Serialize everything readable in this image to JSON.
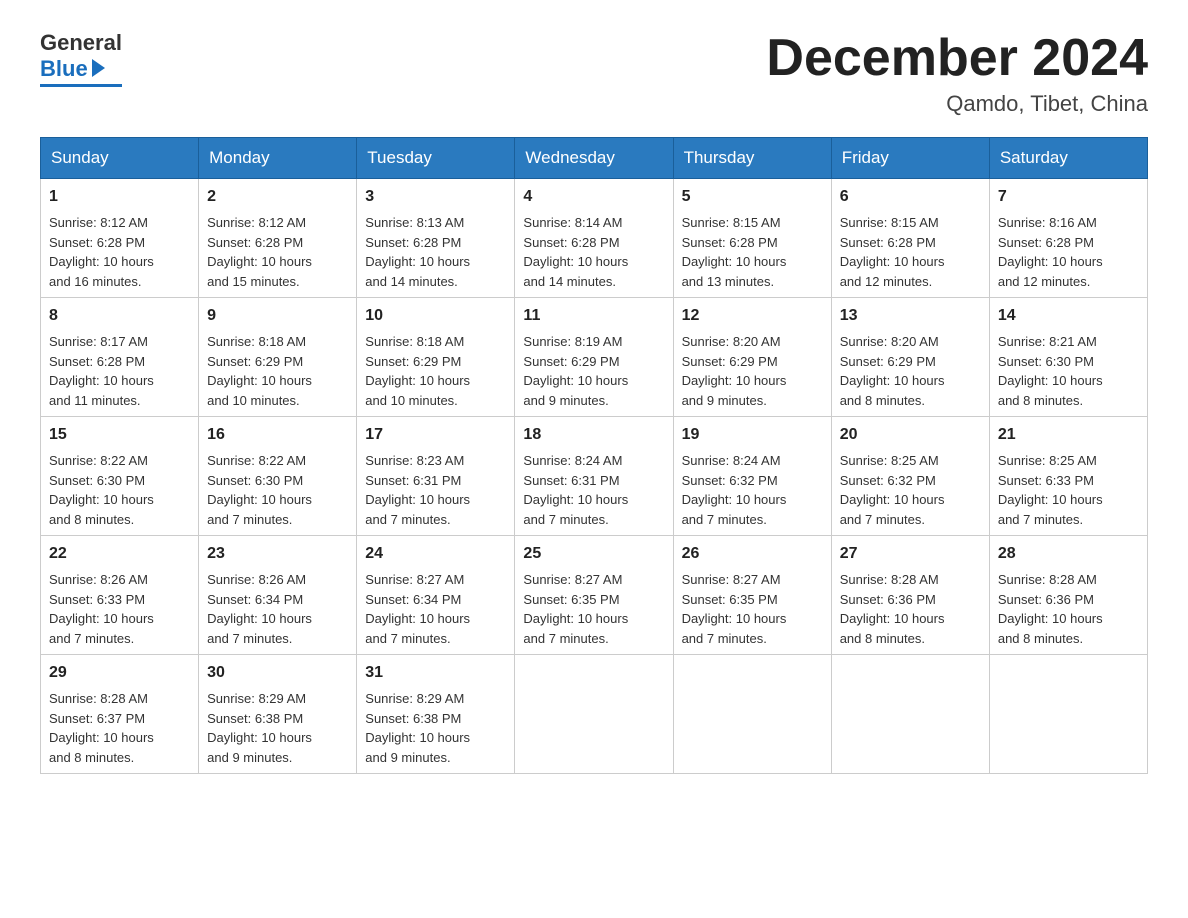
{
  "header": {
    "logo_general": "General",
    "logo_blue": "Blue",
    "month_title": "December 2024",
    "location": "Qamdo, Tibet, China"
  },
  "days_of_week": [
    "Sunday",
    "Monday",
    "Tuesday",
    "Wednesday",
    "Thursday",
    "Friday",
    "Saturday"
  ],
  "weeks": [
    [
      {
        "day": "1",
        "info": "Sunrise: 8:12 AM\nSunset: 6:28 PM\nDaylight: 10 hours\nand 16 minutes."
      },
      {
        "day": "2",
        "info": "Sunrise: 8:12 AM\nSunset: 6:28 PM\nDaylight: 10 hours\nand 15 minutes."
      },
      {
        "day": "3",
        "info": "Sunrise: 8:13 AM\nSunset: 6:28 PM\nDaylight: 10 hours\nand 14 minutes."
      },
      {
        "day": "4",
        "info": "Sunrise: 8:14 AM\nSunset: 6:28 PM\nDaylight: 10 hours\nand 14 minutes."
      },
      {
        "day": "5",
        "info": "Sunrise: 8:15 AM\nSunset: 6:28 PM\nDaylight: 10 hours\nand 13 minutes."
      },
      {
        "day": "6",
        "info": "Sunrise: 8:15 AM\nSunset: 6:28 PM\nDaylight: 10 hours\nand 12 minutes."
      },
      {
        "day": "7",
        "info": "Sunrise: 8:16 AM\nSunset: 6:28 PM\nDaylight: 10 hours\nand 12 minutes."
      }
    ],
    [
      {
        "day": "8",
        "info": "Sunrise: 8:17 AM\nSunset: 6:28 PM\nDaylight: 10 hours\nand 11 minutes."
      },
      {
        "day": "9",
        "info": "Sunrise: 8:18 AM\nSunset: 6:29 PM\nDaylight: 10 hours\nand 10 minutes."
      },
      {
        "day": "10",
        "info": "Sunrise: 8:18 AM\nSunset: 6:29 PM\nDaylight: 10 hours\nand 10 minutes."
      },
      {
        "day": "11",
        "info": "Sunrise: 8:19 AM\nSunset: 6:29 PM\nDaylight: 10 hours\nand 9 minutes."
      },
      {
        "day": "12",
        "info": "Sunrise: 8:20 AM\nSunset: 6:29 PM\nDaylight: 10 hours\nand 9 minutes."
      },
      {
        "day": "13",
        "info": "Sunrise: 8:20 AM\nSunset: 6:29 PM\nDaylight: 10 hours\nand 8 minutes."
      },
      {
        "day": "14",
        "info": "Sunrise: 8:21 AM\nSunset: 6:30 PM\nDaylight: 10 hours\nand 8 minutes."
      }
    ],
    [
      {
        "day": "15",
        "info": "Sunrise: 8:22 AM\nSunset: 6:30 PM\nDaylight: 10 hours\nand 8 minutes."
      },
      {
        "day": "16",
        "info": "Sunrise: 8:22 AM\nSunset: 6:30 PM\nDaylight: 10 hours\nand 7 minutes."
      },
      {
        "day": "17",
        "info": "Sunrise: 8:23 AM\nSunset: 6:31 PM\nDaylight: 10 hours\nand 7 minutes."
      },
      {
        "day": "18",
        "info": "Sunrise: 8:24 AM\nSunset: 6:31 PM\nDaylight: 10 hours\nand 7 minutes."
      },
      {
        "day": "19",
        "info": "Sunrise: 8:24 AM\nSunset: 6:32 PM\nDaylight: 10 hours\nand 7 minutes."
      },
      {
        "day": "20",
        "info": "Sunrise: 8:25 AM\nSunset: 6:32 PM\nDaylight: 10 hours\nand 7 minutes."
      },
      {
        "day": "21",
        "info": "Sunrise: 8:25 AM\nSunset: 6:33 PM\nDaylight: 10 hours\nand 7 minutes."
      }
    ],
    [
      {
        "day": "22",
        "info": "Sunrise: 8:26 AM\nSunset: 6:33 PM\nDaylight: 10 hours\nand 7 minutes."
      },
      {
        "day": "23",
        "info": "Sunrise: 8:26 AM\nSunset: 6:34 PM\nDaylight: 10 hours\nand 7 minutes."
      },
      {
        "day": "24",
        "info": "Sunrise: 8:27 AM\nSunset: 6:34 PM\nDaylight: 10 hours\nand 7 minutes."
      },
      {
        "day": "25",
        "info": "Sunrise: 8:27 AM\nSunset: 6:35 PM\nDaylight: 10 hours\nand 7 minutes."
      },
      {
        "day": "26",
        "info": "Sunrise: 8:27 AM\nSunset: 6:35 PM\nDaylight: 10 hours\nand 7 minutes."
      },
      {
        "day": "27",
        "info": "Sunrise: 8:28 AM\nSunset: 6:36 PM\nDaylight: 10 hours\nand 8 minutes."
      },
      {
        "day": "28",
        "info": "Sunrise: 8:28 AM\nSunset: 6:36 PM\nDaylight: 10 hours\nand 8 minutes."
      }
    ],
    [
      {
        "day": "29",
        "info": "Sunrise: 8:28 AM\nSunset: 6:37 PM\nDaylight: 10 hours\nand 8 minutes."
      },
      {
        "day": "30",
        "info": "Sunrise: 8:29 AM\nSunset: 6:38 PM\nDaylight: 10 hours\nand 9 minutes."
      },
      {
        "day": "31",
        "info": "Sunrise: 8:29 AM\nSunset: 6:38 PM\nDaylight: 10 hours\nand 9 minutes."
      },
      {
        "day": "",
        "info": ""
      },
      {
        "day": "",
        "info": ""
      },
      {
        "day": "",
        "info": ""
      },
      {
        "day": "",
        "info": ""
      }
    ]
  ]
}
